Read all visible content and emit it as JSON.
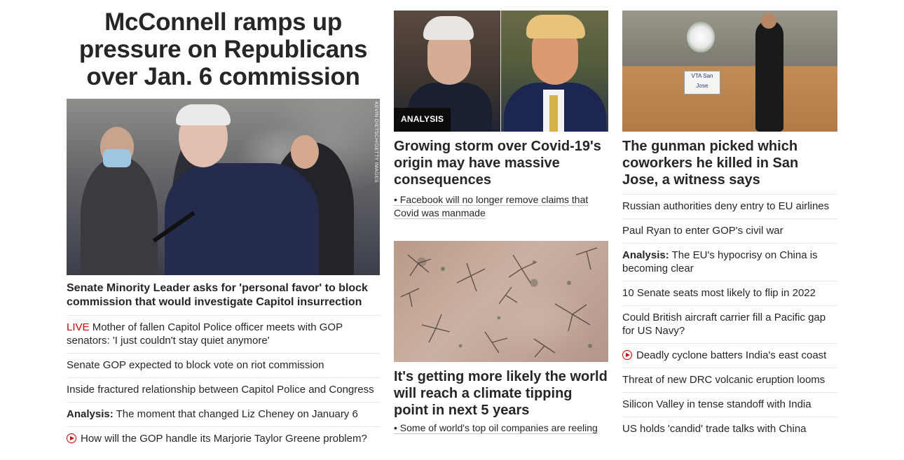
{
  "hero": {
    "headline": "McConnell ramps up pressure on Republicans over Jan. 6 commission",
    "image_credit": "KEVIN DIETSCH/GETTY IMAGES",
    "caption": "Senate Minority Leader asks for 'personal favor' to block commission that would investigate Capitol insurrection"
  },
  "col1_list": [
    {
      "prefix": "LIVE",
      "text": "Mother of fallen Capitol Police officer meets with GOP senators: 'I just couldn't stay quiet anymore'"
    },
    {
      "text": "Senate GOP expected to block vote on riot commission"
    },
    {
      "text": "Inside fractured relationship between Capitol Police and Congress"
    },
    {
      "prefix": "Analysis:",
      "text": "The moment that changed Liz Cheney on January 6"
    },
    {
      "video": true,
      "text": "How will the GOP handle its Marjorie Taylor Greene problem?"
    }
  ],
  "col2": {
    "story1": {
      "badge": "ANALYSIS",
      "title": "Growing storm over Covid-19's origin may have massive consequences",
      "sub": "• Facebook will no longer remove claims that Covid was manmade"
    },
    "story2": {
      "title": "It's getting more likely the world will reach a climate tipping point in next 5 years",
      "sub": "• Some of world's top oil companies are reeling"
    }
  },
  "col3": {
    "sign_text": "VTA San Jose",
    "title": "The gunman picked which coworkers he killed in San Jose, a witness says",
    "list": [
      {
        "text": "Russian authorities deny entry to EU airlines"
      },
      {
        "text": "Paul Ryan to enter GOP's civil war"
      },
      {
        "prefix": "Analysis:",
        "text": "The EU's hypocrisy on China is becoming clear"
      },
      {
        "text": "10 Senate seats most likely to flip in 2022"
      },
      {
        "text": "Could British aircraft carrier fill a Pacific gap for US Navy?"
      },
      {
        "video": true,
        "text": "Deadly cyclone batters India's east coast"
      },
      {
        "text": "Threat of new DRC volcanic eruption looms"
      },
      {
        "text": "Silicon Valley in tense standoff with India"
      },
      {
        "text": "US holds 'candid' trade talks with China"
      }
    ]
  },
  "colors": {
    "live": "#cc0000",
    "text": "#262626",
    "divider": "#e6e6e6",
    "badge_bg": "#0c0c0c"
  }
}
